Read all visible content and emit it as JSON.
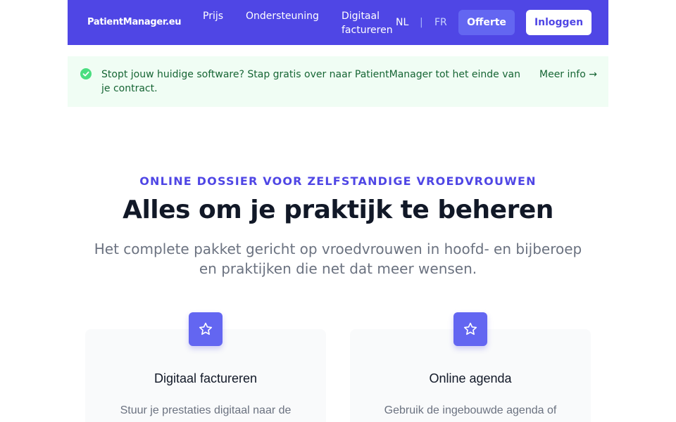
{
  "header": {
    "logo": "PatientManager.eu",
    "nav": [
      {
        "label": "Prijs"
      },
      {
        "label": "Ondersteuning"
      },
      {
        "label": "Digitaal factureren"
      }
    ],
    "languages": {
      "nl": "NL",
      "separator": "|",
      "fr": "FR",
      "active": "NL"
    },
    "offerte_label": "Offerte",
    "login_label": "Inloggen",
    "background_color": "#4f46e5"
  },
  "banner": {
    "icon": "check-circle-icon",
    "text": "Stopt jouw huidige software? Stap gratis over naar PatientManager tot het einde van je contract.",
    "link_label": "Meer info →",
    "color": "#166534"
  },
  "hero": {
    "eyebrow": "ONLINE DOSSIER VOOR ZELFSTANDIGE VROEDVROUWEN",
    "title": "Alles om je praktijk te beheren",
    "subtitle": "Het complete pakket gericht op vroedvrouwen in hoofd- en bijberoep en praktijken die net dat meer wensen."
  },
  "features": [
    {
      "icon": "star-icon",
      "title": "Digitaal factureren",
      "text": "Stuur je prestaties digitaal naar de"
    },
    {
      "icon": "star-icon",
      "title": "Online agenda",
      "text": "Gebruik de ingebouwde agenda of"
    }
  ]
}
